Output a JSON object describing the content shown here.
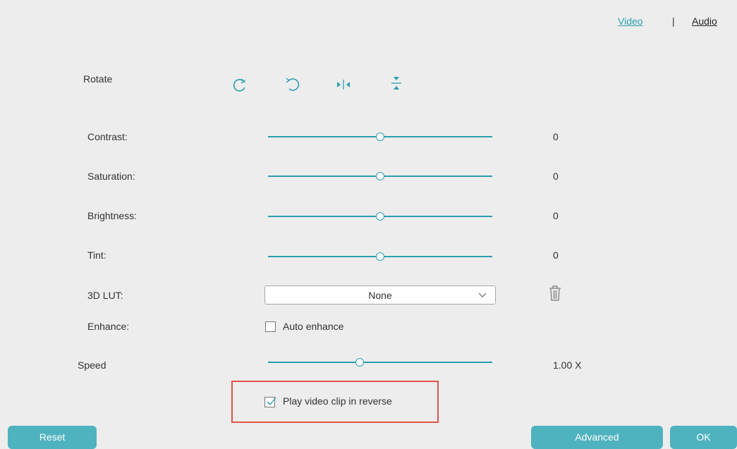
{
  "tabs": {
    "video": "Video",
    "separator": "|",
    "audio": "Audio"
  },
  "rotate": {
    "label": "Rotate"
  },
  "adjustments": [
    {
      "label": "Contrast:",
      "value": "0",
      "level": 0.5
    },
    {
      "label": "Saturation:",
      "value": "0",
      "level": 0.5
    },
    {
      "label": "Brightness:",
      "value": "0",
      "level": 0.5
    },
    {
      "label": "Tint:",
      "value": "0",
      "level": 0.5
    }
  ],
  "lut": {
    "label": "3D LUT:",
    "selected": "None"
  },
  "enhance": {
    "label": "Enhance:",
    "checkbox_label": "Auto enhance",
    "checked": false
  },
  "speed": {
    "label": "Speed",
    "value": "1.00 X",
    "level": 0.41
  },
  "reverse": {
    "label": "Play video clip in reverse",
    "checked": true
  },
  "buttons": {
    "reset": "Reset",
    "advanced": "Advanced",
    "ok": "OK"
  },
  "colors": {
    "accent": "#2a9fb0",
    "button": "#4fb3bf",
    "highlight": "#e0524a",
    "background": "#ededed"
  }
}
